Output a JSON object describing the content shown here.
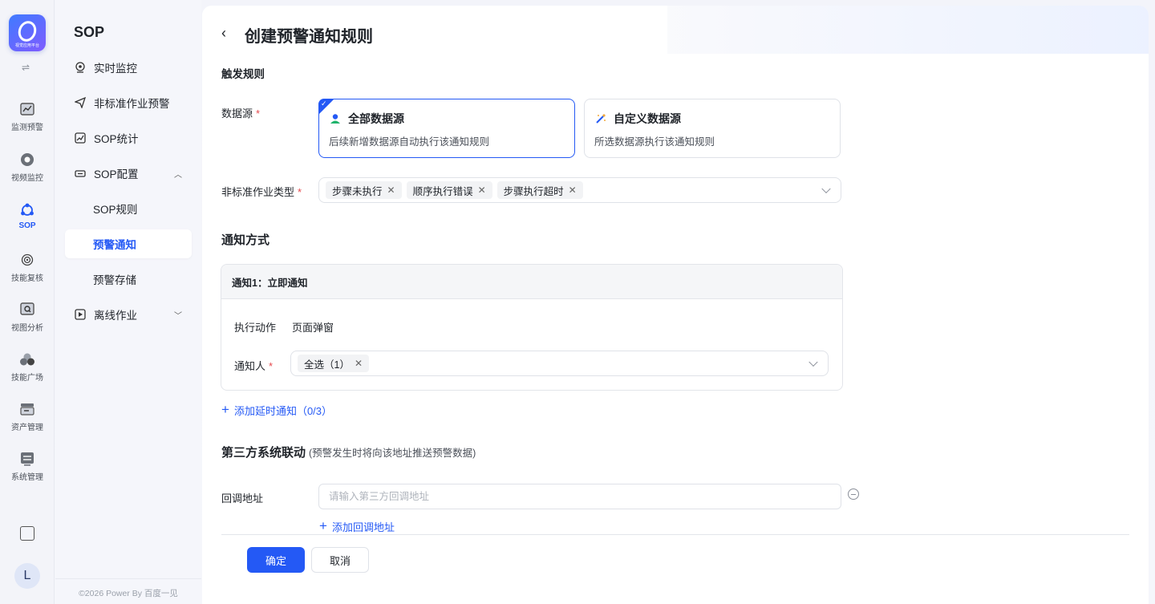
{
  "rail": {
    "logo_sub": "视觉应用平台",
    "items": [
      {
        "label": "监测预警",
        "icon": "chart-icon"
      },
      {
        "label": "视频监控",
        "icon": "camera-icon"
      },
      {
        "label": "SOP",
        "icon": "sop-icon"
      },
      {
        "label": "技能复核",
        "icon": "target-icon"
      },
      {
        "label": "视图分析",
        "icon": "image-search-icon"
      },
      {
        "label": "技能广场",
        "icon": "cluster-icon"
      },
      {
        "label": "资产管理",
        "icon": "asset-icon"
      },
      {
        "label": "系统管理",
        "icon": "settings-panel-icon"
      }
    ],
    "avatar": "L"
  },
  "sidebar": {
    "title": "SOP",
    "items": [
      {
        "label": "实时监控"
      },
      {
        "label": "非标准作业预警"
      },
      {
        "label": "SOP统计"
      },
      {
        "label": "SOP配置"
      },
      {
        "label": "SOP规则"
      },
      {
        "label": "预警通知"
      },
      {
        "label": "预警存储"
      },
      {
        "label": "离线作业"
      }
    ],
    "footer": "©2026 Power By 百度一见"
  },
  "page": {
    "title": "创建预警通知规则",
    "trigger_section": "触发规则",
    "datasource_label": "数据源",
    "datasource_options": [
      {
        "title": "全部数据源",
        "desc": "后续新增数据源自动执行该通知规则"
      },
      {
        "title": "自定义数据源",
        "desc": "所选数据源执行该通知规则"
      }
    ],
    "type_label": "非标准作业类型",
    "type_tags": [
      "步骤未执行",
      "顺序执行错误",
      "步骤执行超时"
    ],
    "notify_section": "通知方式",
    "notice1": {
      "header": "通知1：立即通知",
      "action_label": "执行动作",
      "action_value": "页面弹窗",
      "recipient_label": "通知人",
      "recipient_tag": "全选（1）"
    },
    "add_delay": "添加延时通知（0/3）",
    "third_party_section": "第三方系统联动",
    "third_party_hint": "(预警发生时将向该地址推送预警数据)",
    "callback_label": "回调地址",
    "callback_placeholder": "请输入第三方回调地址",
    "add_callback": "添加回调地址",
    "confirm": "确定",
    "cancel": "取消"
  },
  "colors": {
    "accent": "#2459f5",
    "required": "#e5484d"
  }
}
